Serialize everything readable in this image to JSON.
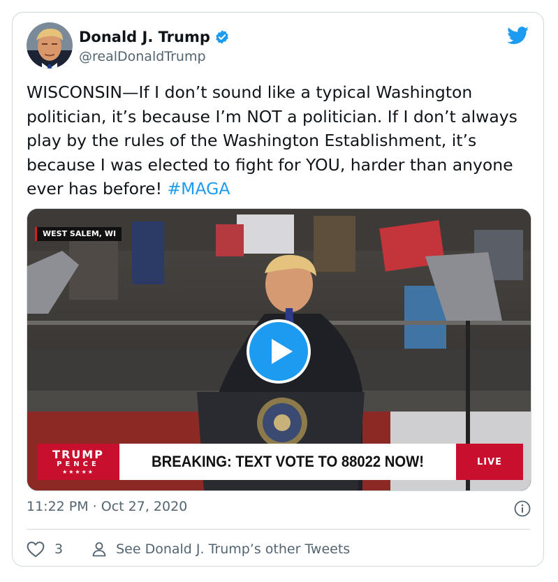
{
  "tweet": {
    "display_name": "Donald J. Trump",
    "handle": "@realDonaldTrump",
    "text_main": "WISCONSIN—If I don’t sound like a typical Washington politician, it’s because I’m NOT a politician. If I don’t always play by the rules of the Washington Establishment, it’s because I was elected to fight for YOU, harder than anyone ever has before! ",
    "hashtag": "#MAGA",
    "timestamp": "11:22 PM · Oct 27, 2020",
    "like_count": "3",
    "other_tweets_link": "See Donald J. Trump’s other Tweets"
  },
  "video": {
    "location_tag": "WEST SALEM, WI",
    "brand_line1": "TRUMP",
    "brand_line2": "PENCE",
    "brand_stars": "★★★★★",
    "ticker_text": "BREAKING: TEXT VOTE TO 88022 NOW!",
    "live_label": "LIVE"
  },
  "icons": {
    "verified": "verified-badge-icon",
    "bird": "twitter-bird-icon",
    "play": "play-icon",
    "info": "info-icon",
    "heart": "heart-icon",
    "person": "person-icon"
  },
  "colors": {
    "accent": "#1d9bf0",
    "secondary_text": "#536471",
    "border": "#cfd9de",
    "banner_red": "#c8102e"
  }
}
